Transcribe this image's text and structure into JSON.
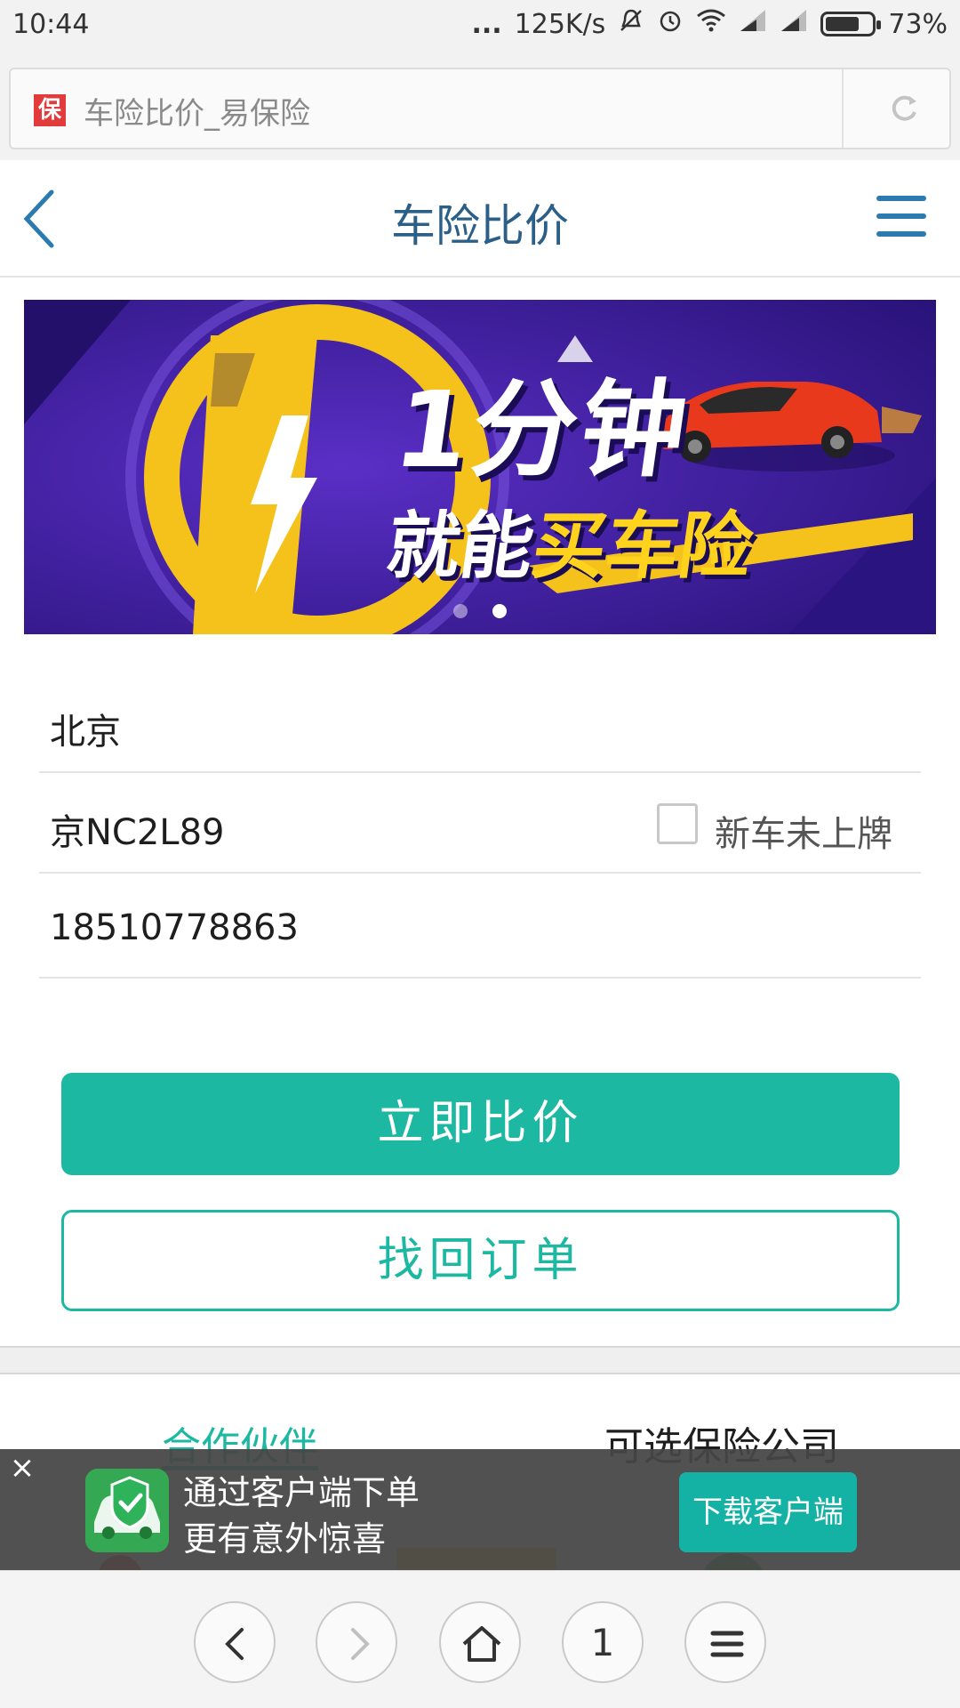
{
  "status_bar": {
    "time": "10:44",
    "dots": "...",
    "speed": "125K/s",
    "battery": "73%",
    "battery_level": 0.73
  },
  "address_bar": {
    "site_icon_text": "保",
    "page_title": "车险比价_易保险"
  },
  "header": {
    "title": "车险比价"
  },
  "banner": {
    "line1": "1分钟",
    "line2_a": "就能",
    "line2_b": "买车险",
    "dots": 2,
    "active_dot": 2
  },
  "form": {
    "city": "北京",
    "plate": "京NC2L89",
    "new_car_label": "新车未上牌",
    "new_car_checked": false,
    "phone": "18510778863"
  },
  "buttons": {
    "compare": "立即比价",
    "retrieve": "找回订单"
  },
  "tabs": {
    "partners": "合作伙伴",
    "companies": "可选保险公司",
    "active": "partners"
  },
  "promo": {
    "close": "×",
    "line1": "通过客户端下单",
    "line2": "更有意外惊喜",
    "download": "下载客户端"
  },
  "browser_nav": {
    "tab_count": "1"
  },
  "colors": {
    "accent": "#1cb8a2",
    "header_title": "#2b5f88",
    "menu": "#2b7bb0"
  }
}
